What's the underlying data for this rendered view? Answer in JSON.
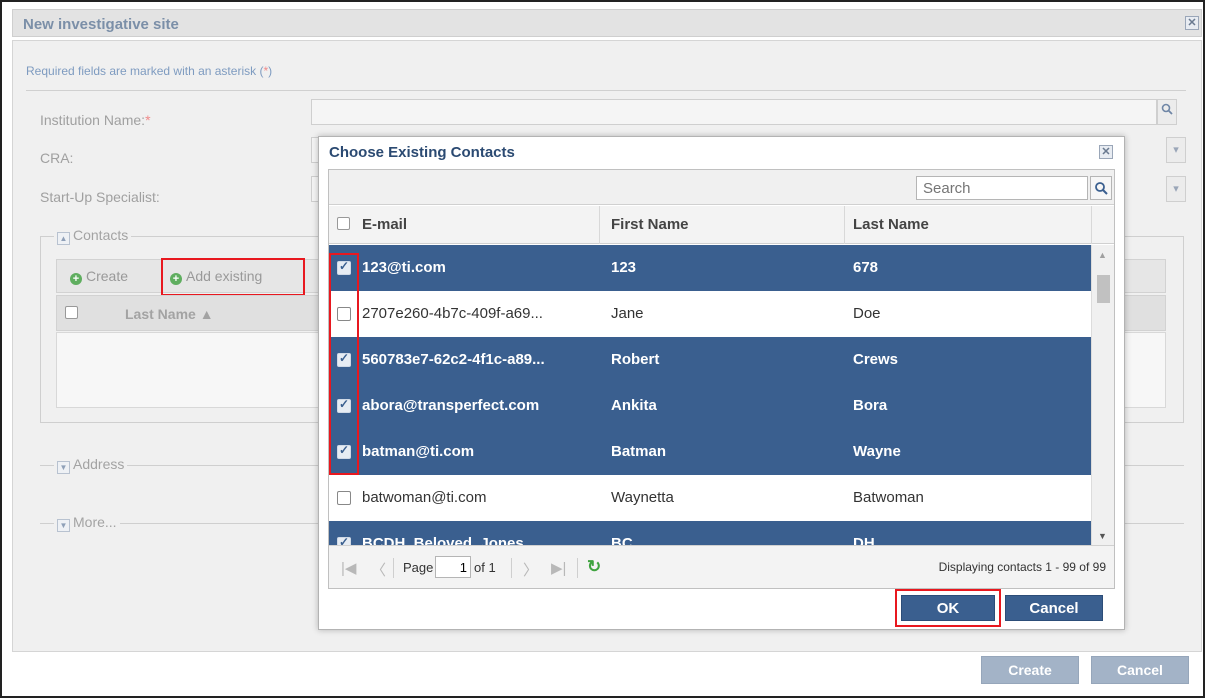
{
  "window": {
    "title": "New investigative site",
    "required_note": "Required fields are marked with an asterisk (",
    "required_asterisk": "*",
    "required_note_end": ")"
  },
  "fields": {
    "institution_label": "Institution Name:",
    "cra_label": "CRA:",
    "startup_label": "Start-Up Specialist:",
    "asterisk": "*"
  },
  "contacts": {
    "legend": "Contacts",
    "create_label": "Create",
    "add_existing_label": "Add existing",
    "col_last_name": "Last Name ▲"
  },
  "sections": {
    "address": "Address",
    "more": "More..."
  },
  "footer": {
    "create_label": "Create",
    "cancel_label": "Cancel"
  },
  "modal": {
    "title": "Choose Existing Contacts",
    "search_placeholder": "Search",
    "columns": {
      "email": "E-mail",
      "first_name": "First Name",
      "last_name": "Last Name"
    },
    "rows": [
      {
        "email": "123@ti.com",
        "first_name": "123",
        "last_name": "678",
        "selected": true
      },
      {
        "email": "2707e260-4b7c-409f-a69...",
        "first_name": "Jane",
        "last_name": "Doe",
        "selected": false
      },
      {
        "email": "560783e7-62c2-4f1c-a89...",
        "first_name": "Robert",
        "last_name": "Crews",
        "selected": true
      },
      {
        "email": "abora@transperfect.com",
        "first_name": "Ankita",
        "last_name": "Bora",
        "selected": true
      },
      {
        "email": "batman@ti.com",
        "first_name": "Batman",
        "last_name": "Wayne",
        "selected": true
      },
      {
        "email": "batwoman@ti.com",
        "first_name": "Waynetta",
        "last_name": "Batwoman",
        "selected": false
      },
      {
        "email": "BCDH_Beloved_Jones",
        "first_name": "BC",
        "last_name": "DH",
        "selected": true
      }
    ],
    "pager": {
      "page_label": "Page",
      "page_value": "1",
      "of_label": "of 1",
      "display_info": "Displaying contacts 1 - 99 of 99"
    },
    "ok_label": "OK",
    "cancel_label": "Cancel"
  },
  "colors": {
    "selected_row": "#3a5f8f",
    "highlight": "#e8181f",
    "title_blue": "#2b4a72"
  }
}
